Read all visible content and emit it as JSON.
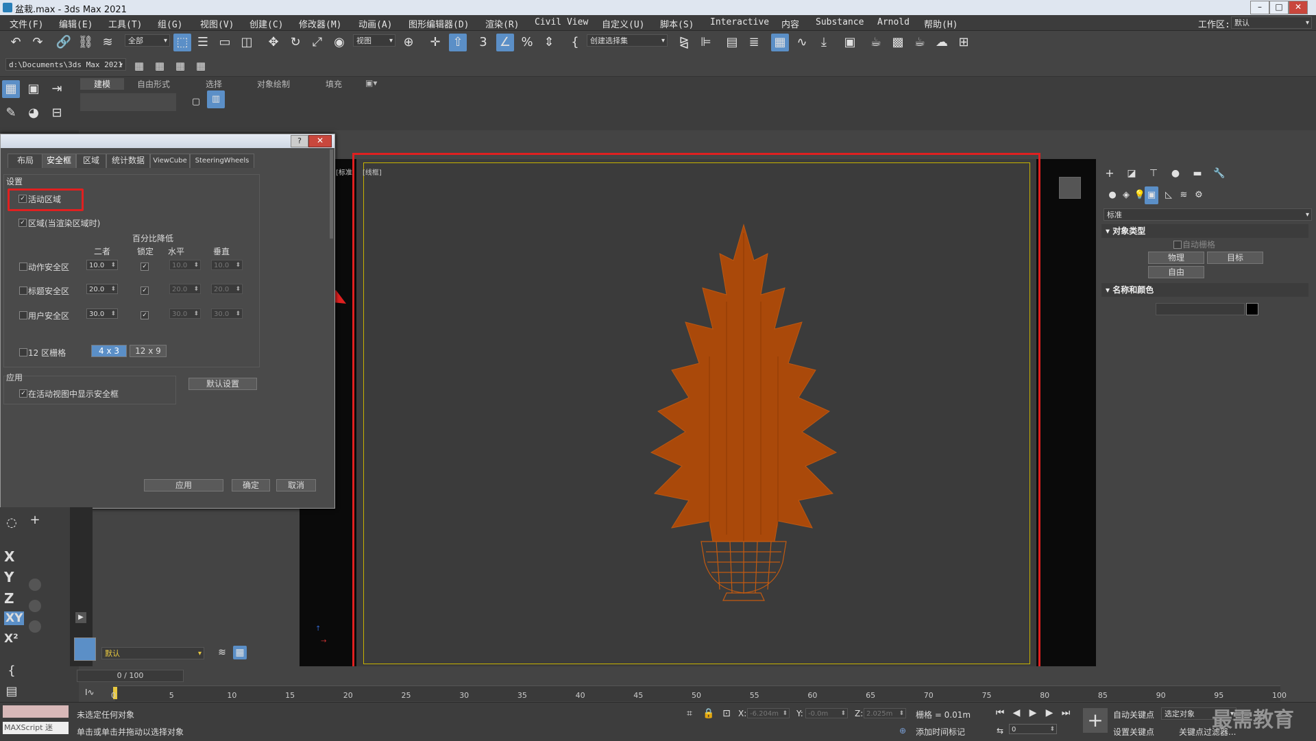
{
  "window": {
    "title": "盆栽.max - 3ds Max 2021",
    "controls": [
      "–",
      "□",
      "✕"
    ]
  },
  "menubar": {
    "items": [
      "文件(F)",
      "编辑(E)",
      "工具(T)",
      "组(G)",
      "视图(V)",
      "创建(C)",
      "修改器(M)",
      "动画(A)",
      "图形编辑器(D)",
      "渲染(R)",
      "Civil View",
      "自定义(U)",
      "脚本(S)",
      "Interactive",
      "内容",
      "Substance",
      "Arnold",
      "帮助(H)"
    ],
    "workspace_label": "工作区:",
    "workspace_value": "默认"
  },
  "toolbar": {
    "selection_filter": "全部",
    "reference_coord": "视图",
    "named_selection": "创建选择集",
    "project_path": "d:\\Documents\\3ds Max 2021"
  },
  "ribbon": {
    "tabs": [
      "建模",
      "自由形式",
      "选择",
      "对象绘制",
      "填充"
    ]
  },
  "dialog": {
    "title_help": "?",
    "title_close": "✕",
    "tabs": [
      "布局",
      "安全框",
      "区域",
      "统计数据",
      "ViewCube",
      "SteeringWheels"
    ],
    "settings_label": "设置",
    "live_area": "活动区域",
    "region_label": "区域(当渲染区域时)",
    "percent_header": "百分比降低",
    "col_both": "二者",
    "col_lock": "锁定",
    "col_horizontal": "水平",
    "col_vertical": "垂直",
    "rows": [
      {
        "label": "动作安全区",
        "both": "10.0",
        "h": "10.0",
        "v": "10.0"
      },
      {
        "label": "标题安全区",
        "both": "20.0",
        "h": "20.0",
        "v": "20.0"
      },
      {
        "label": "用户安全区",
        "both": "30.0",
        "h": "30.0",
        "v": "30.0"
      }
    ],
    "grid_label": "12 区栅格",
    "grid_opt1": "4 x 3",
    "grid_opt2": "12 x 9",
    "apply_section": "应用",
    "show_in_active": "在活动视图中显示安全框",
    "default_btn": "默认设置",
    "apply_btn": "应用",
    "ok_btn": "确定",
    "cancel_btn": "取消"
  },
  "viewport": {
    "label1": "[标准]",
    "label2": "[线框]"
  },
  "command_panel": {
    "category_value": "标准",
    "object_type": "对象类型",
    "auto_grid": "自动栅格",
    "btn_physical": "物理",
    "btn_target": "目标",
    "btn_free": "自由",
    "name_color": "名称和颜色"
  },
  "left_panel": {
    "axes": [
      "X",
      "Y",
      "Z",
      "XY",
      "X²"
    ],
    "layer": "默认"
  },
  "timeline": {
    "frame_counter": "0 / 100",
    "ticks": [
      "0",
      "5",
      "10",
      "15",
      "20",
      "25",
      "30",
      "35",
      "40",
      "45",
      "50",
      "55",
      "60",
      "65",
      "70",
      "75",
      "80",
      "85",
      "90",
      "95",
      "100"
    ]
  },
  "status": {
    "maxscript": "MAXScript 迷",
    "line1": "未选定任何对象",
    "line2": "单击或单击并拖动以选择对象",
    "x_label": "X:",
    "x_value": "-6.204m",
    "y_label": "Y:",
    "y_value": "-0.0m",
    "z_label": "Z:",
    "z_value": "2.025m",
    "grid": "栅格 = 0.01m",
    "add_time_tag": "添加时间标记",
    "auto_key": "自动关键点",
    "selected_obj": "选定对象",
    "set_key": "设置关键点",
    "key_filter": "关键点过滤器...",
    "frame": "0",
    "watermark": "最需教育"
  }
}
